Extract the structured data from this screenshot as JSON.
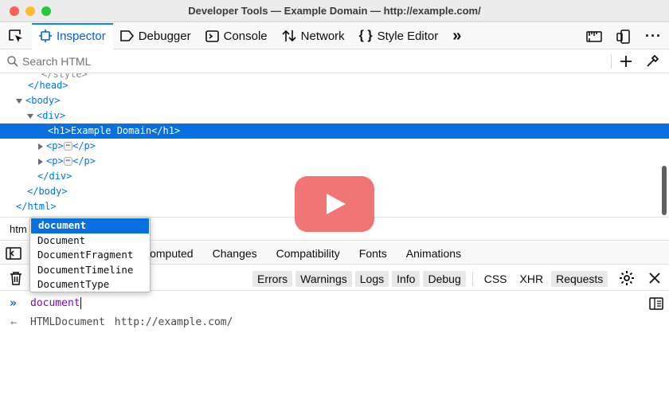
{
  "window": {
    "title": "Developer Tools — Example Domain — http://example.com/"
  },
  "toolbar": {
    "tabs": [
      {
        "label": "Inspector",
        "icon": "inspector-icon"
      },
      {
        "label": "Debugger",
        "icon": "debugger-icon"
      },
      {
        "label": "Console",
        "icon": "console-icon"
      },
      {
        "label": "Network",
        "icon": "network-icon"
      },
      {
        "label": "Style Editor",
        "icon": "braces-icon"
      }
    ],
    "more": "»"
  },
  "search": {
    "placeholder": "Search HTML"
  },
  "markup": {
    "head_close": "</head>",
    "body_open": "<body>",
    "div_open": "<div>",
    "h1": "<h1>Example Domain</h1>",
    "p_open": "<p>",
    "ellipsis": "⋯",
    "p_close": "</p>",
    "div_close": "</div>",
    "body_close": "</body>",
    "html_close": "</html>"
  },
  "breadcrumbs": {
    "text": "htm"
  },
  "lower_tabs": [
    "Computed",
    "Changes",
    "Compatibility",
    "Fonts",
    "Animations"
  ],
  "console_filters": [
    "Errors",
    "Warnings",
    "Logs",
    "Info",
    "Debug"
  ],
  "console_filters_plain": [
    "CSS",
    "XHR"
  ],
  "console_requests": "Requests",
  "console": {
    "input": "document",
    "result_type": "HTMLDocument",
    "result_url": "http://example.com/"
  },
  "autocomplete": [
    "document",
    "Document",
    "DocumentFragment",
    "DocumentTimeline",
    "DocumentType"
  ],
  "colors": {
    "accent": "#0a84ff",
    "selected": "#0a70e0",
    "play": "#f26b6b"
  }
}
